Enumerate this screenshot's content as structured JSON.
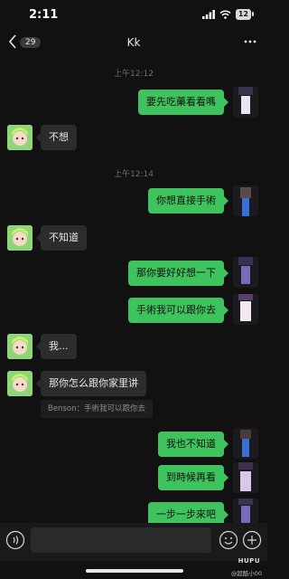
{
  "status_bar": {
    "time": "2:11",
    "battery": "12"
  },
  "header": {
    "back_count": "29",
    "title": "Kk"
  },
  "timestamps": [
    "上午12:12",
    "上午12:14"
  ],
  "messages": [
    {
      "side": "out",
      "text": "要先吃藥看看嗎"
    },
    {
      "side": "in",
      "text": "不想"
    },
    {
      "side": "out",
      "text": "你想直接手術"
    },
    {
      "side": "in",
      "text": "不知道"
    },
    {
      "side": "out",
      "text": "那你要好好想一下"
    },
    {
      "side": "out",
      "text": "手術我可以跟你去"
    },
    {
      "side": "in",
      "text": "我..."
    },
    {
      "side": "in",
      "text": "那你怎么跟你家里讲"
    },
    {
      "side": "out",
      "text": "我也不知道"
    },
    {
      "side": "out",
      "text": "到時候再看"
    },
    {
      "side": "out",
      "text": "一步一步來吧"
    }
  ],
  "quote": {
    "text": "Benson：手術我可以跟你去"
  },
  "input_bar": {
    "placeholder": ""
  },
  "watermark": {
    "logo": "HUPU",
    "user": "@超酷小00"
  },
  "colors": {
    "background": "#111111",
    "outgoing_bubble": "#3ec35e",
    "incoming_bubble": "#2c2c2c"
  }
}
